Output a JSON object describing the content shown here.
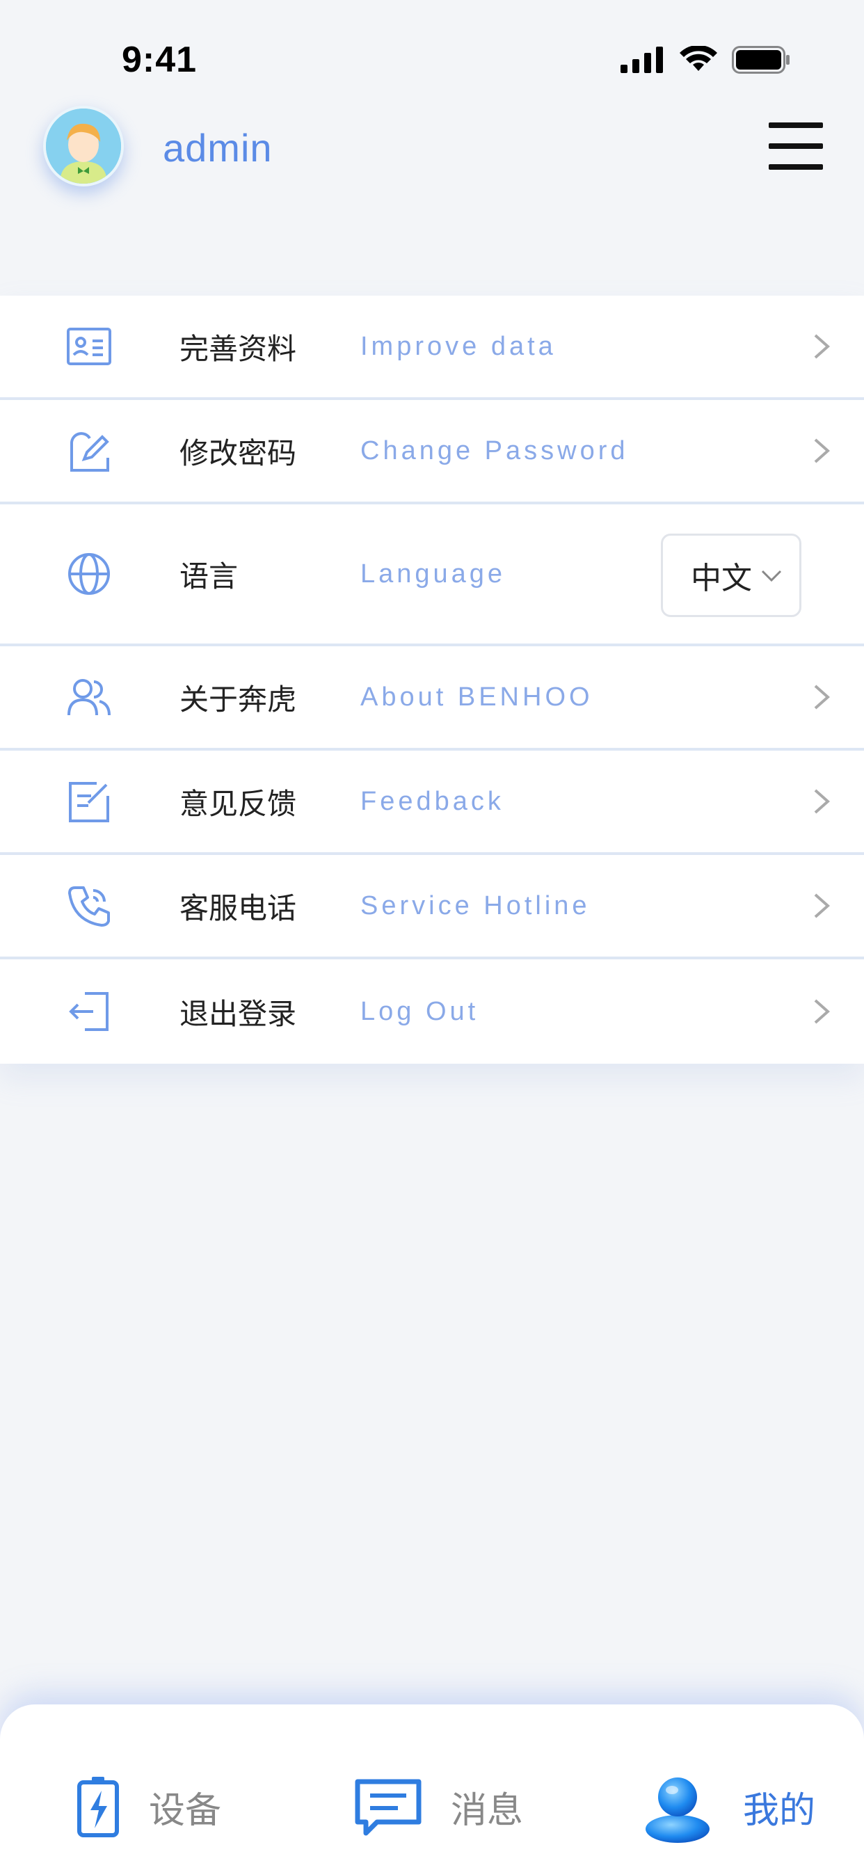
{
  "status_bar": {
    "time": "9:41"
  },
  "header": {
    "username": "admin"
  },
  "menu": [
    {
      "cn": "完善资料",
      "en": "Improve data",
      "icon": "profile-card-icon"
    },
    {
      "cn": "修改密码",
      "en": "Change Password",
      "icon": "edit-lock-icon"
    },
    {
      "cn": "语言",
      "en": "Language",
      "icon": "globe-icon",
      "selected": "中文"
    },
    {
      "cn": "关于奔虎",
      "en": "About BENHOO",
      "icon": "users-icon"
    },
    {
      "cn": "意见反馈",
      "en": "Feedback",
      "icon": "feedback-icon"
    },
    {
      "cn": "客服电话",
      "en": "Service Hotline",
      "icon": "phone-icon"
    },
    {
      "cn": "退出登录",
      "en": "Log Out",
      "icon": "logout-icon"
    }
  ],
  "tabbar": {
    "devices": "设备",
    "messages": "消息",
    "mine": "我的"
  },
  "colors": {
    "accent": "#5b8be6",
    "menu_icon": "#6f9ae8",
    "active_tab": "#3a78dd"
  }
}
